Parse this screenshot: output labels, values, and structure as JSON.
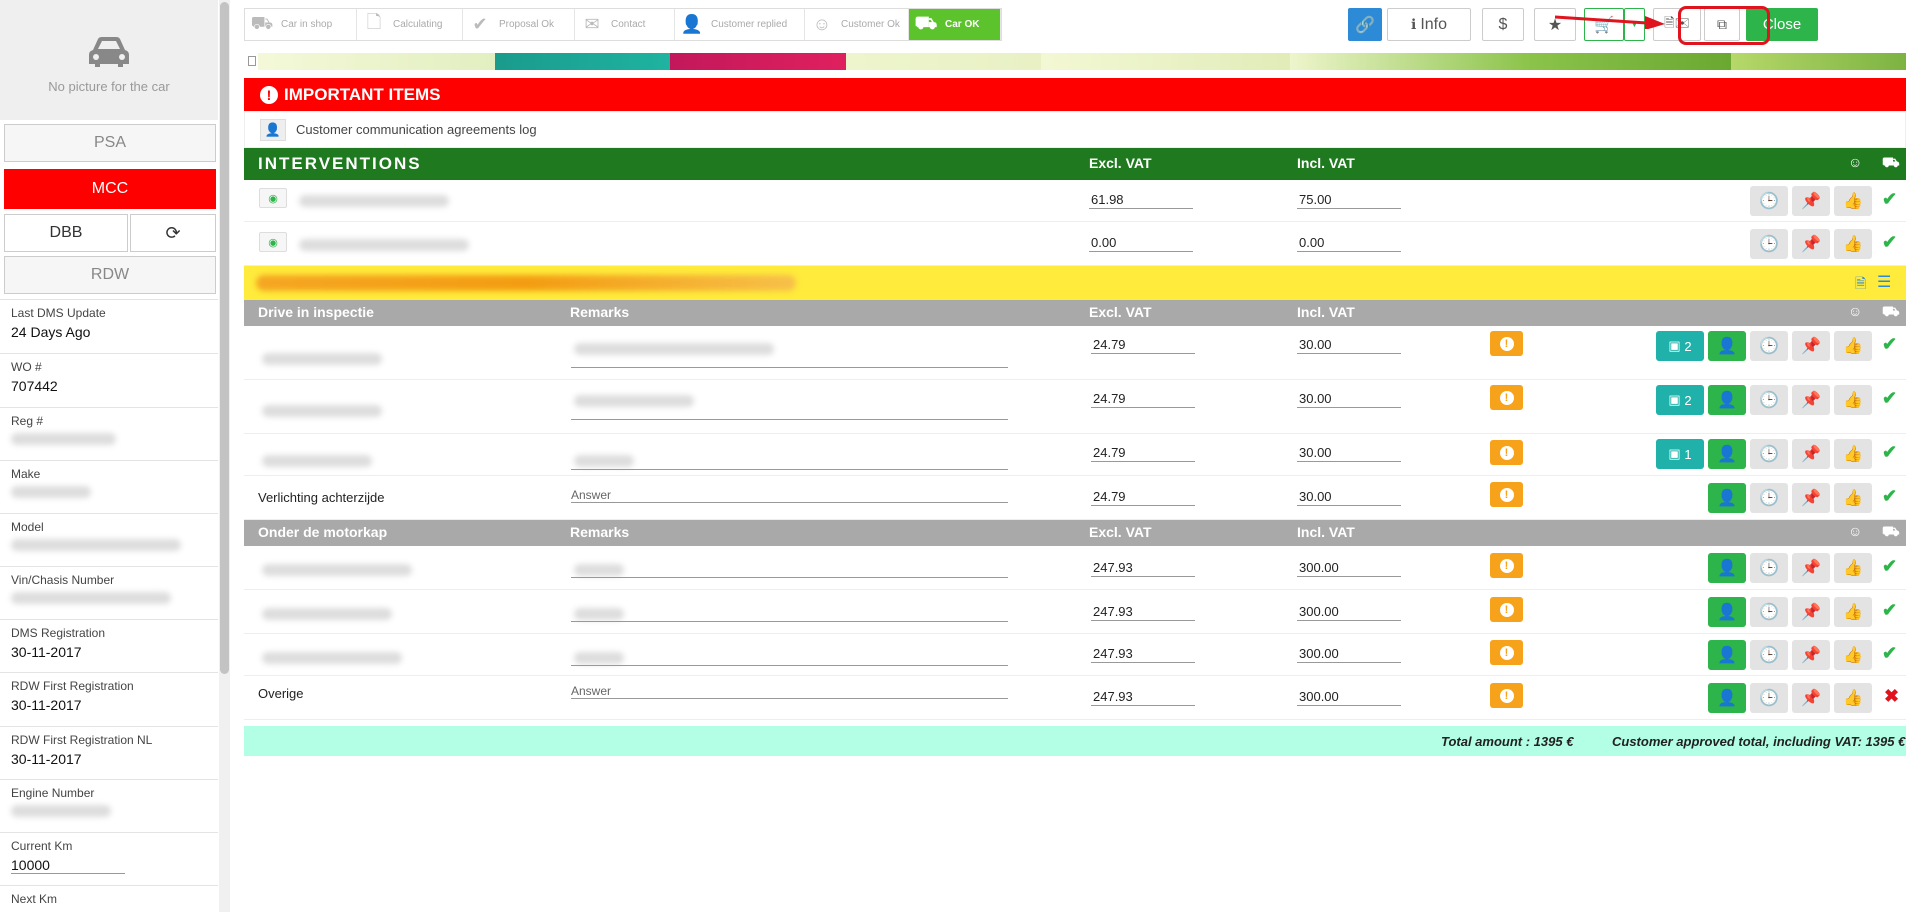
{
  "sidebar": {
    "no_picture": "No picture for the car",
    "buttons": {
      "psa": "PSA",
      "mcc": "MCC",
      "dbb": "DBB",
      "rdw": "RDW"
    },
    "fields": [
      {
        "label": "Last DMS Update",
        "value": "24 Days Ago"
      },
      {
        "label": "WO #",
        "value": "707442"
      },
      {
        "label": "Reg #",
        "value": ""
      },
      {
        "label": "Make",
        "value": ""
      },
      {
        "label": "Model",
        "value": ""
      },
      {
        "label": "Vin/Chasis Number",
        "value": ""
      },
      {
        "label": "DMS Registration",
        "value": "30-11-2017"
      },
      {
        "label": "RDW First Registration",
        "value": "30-11-2017"
      },
      {
        "label": "RDW First Registration NL",
        "value": "30-11-2017"
      },
      {
        "label": "Engine Number",
        "value": ""
      },
      {
        "label": "Current Km",
        "value": "10000"
      },
      {
        "label": "Next Km",
        "value": ""
      }
    ]
  },
  "steps": [
    {
      "label": "Car in shop",
      "icon": "car-icon"
    },
    {
      "label": "Calculating",
      "icon": "document-icon"
    },
    {
      "label": "Proposal Ok",
      "icon": "check-icon"
    },
    {
      "label": "Contact",
      "icon": "envelope-icon"
    },
    {
      "label": "Customer replied",
      "icon": "user-check-icon"
    },
    {
      "label": "Customer Ok",
      "icon": "smiley-icon"
    },
    {
      "label": "Car OK",
      "icon": "car-icon"
    }
  ],
  "toolbar": {
    "info": "Info",
    "dollar": "$",
    "close": "Close"
  },
  "important": {
    "title": "IMPORTANT ITEMS",
    "comm_log": "Customer communication agreements log"
  },
  "interventions": {
    "title": "INTERVENTIONS",
    "excl": "Excl. VAT",
    "incl": "Incl. VAT",
    "rows": [
      {
        "excl": "61.98",
        "incl": "75.00"
      },
      {
        "excl": "0.00",
        "incl": "0.00"
      }
    ]
  },
  "sections": [
    {
      "title": "Drive in inspectie",
      "remarks": "Remarks",
      "excl": "Excl. VAT",
      "incl": "Incl. VAT",
      "rows": [
        {
          "name": "",
          "remark": "",
          "excl": "24.79",
          "incl": "30.00",
          "photos": "2",
          "status": "ok"
        },
        {
          "name": "",
          "remark": "",
          "excl": "24.79",
          "incl": "30.00",
          "photos": "2",
          "status": "ok"
        },
        {
          "name": "",
          "remark": "",
          "excl": "24.79",
          "incl": "30.00",
          "photos": "1",
          "status": "ok"
        },
        {
          "name": "Verlichting achterzijde",
          "remark": "Answer",
          "excl": "24.79",
          "incl": "30.00",
          "photos": "",
          "status": "ok"
        }
      ]
    },
    {
      "title": "Onder de motorkap",
      "remarks": "Remarks",
      "excl": "Excl. VAT",
      "incl": "Incl. VAT",
      "rows": [
        {
          "name": "",
          "remark": "",
          "excl": "247.93",
          "incl": "300.00",
          "photos": "",
          "status": "ok"
        },
        {
          "name": "",
          "remark": "",
          "excl": "247.93",
          "incl": "300.00",
          "photos": "",
          "status": "ok"
        },
        {
          "name": "",
          "remark": "",
          "excl": "247.93",
          "incl": "300.00",
          "photos": "",
          "status": "ok"
        },
        {
          "name": "Overige",
          "remark": "Answer",
          "excl": "247.93",
          "incl": "300.00",
          "photos": "",
          "status": "rejected"
        }
      ]
    }
  ],
  "totals": {
    "total_amount": "Total amount : 1395 €",
    "customer_total": "Customer approved total, including VAT: 1395 €"
  },
  "colors": {
    "red": "#ff0000",
    "green": "#1f7a1f",
    "accent_green": "#2db44a",
    "yellow": "#ffeb3b",
    "teal": "#20b2aa",
    "orange": "#f7a21b",
    "total_bg": "#b2ffe6"
  }
}
